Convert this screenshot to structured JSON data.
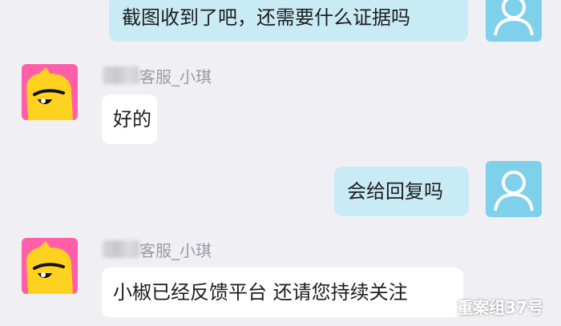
{
  "messages": [
    {
      "direction": "outgoing",
      "text": "截图收到了吧，还需要什么证据吗"
    },
    {
      "direction": "incoming",
      "sender": "客服_小琪",
      "text": "好的"
    },
    {
      "direction": "outgoing",
      "text": "会给回复吗"
    },
    {
      "direction": "incoming",
      "sender": "客服_小琪",
      "text": "小椒已经反馈平台 还请您持续关注"
    }
  ],
  "watermark": {
    "text": "重案组37号",
    "icon": "wechat-icon"
  },
  "colors": {
    "background": "#f0f0f4",
    "outgoing_bubble": "#c9ebf6",
    "incoming_bubble": "#ffffff",
    "user_avatar_bg": "#7fd0ea",
    "agent_avatar_bg": "#ff5fa8",
    "agent_avatar_face": "#ffd21f"
  }
}
